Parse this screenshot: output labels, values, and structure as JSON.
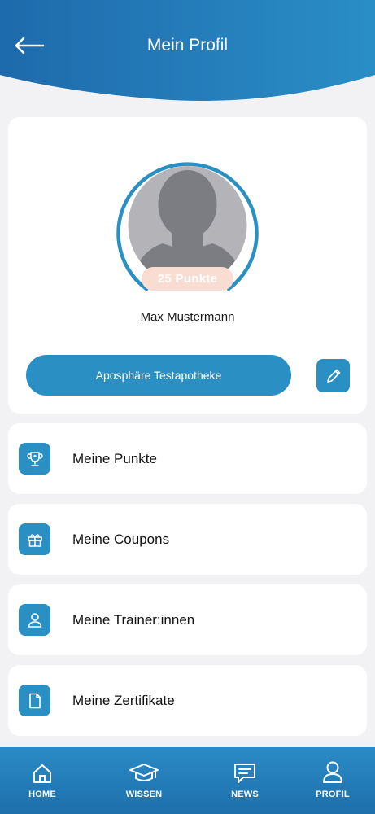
{
  "header": {
    "title": "Mein Profil",
    "back_icon": "arrow-left-icon",
    "gradient_from": "#1e6aab",
    "gradient_to": "#2a8ec6"
  },
  "profile": {
    "points_badge": "25 Punkte",
    "name": "Max Mustermann",
    "pharmacy_button": "Aposphäre Testapotheke",
    "edit_icon": "pencil-icon",
    "progress_ring_color": "#2a8fc3"
  },
  "menu": {
    "items": [
      {
        "label": "Meine Punkte",
        "icon": "trophy-icon"
      },
      {
        "label": "Meine Coupons",
        "icon": "gift-icon"
      },
      {
        "label": "Meine Trainer:innen",
        "icon": "person-icon"
      },
      {
        "label": "Meine Zertifikate",
        "icon": "document-icon"
      }
    ]
  },
  "bottom_nav": {
    "items": [
      {
        "label": "HOME",
        "icon": "home-icon"
      },
      {
        "label": "WISSEN",
        "icon": "graduation-cap-icon"
      },
      {
        "label": "NEWS",
        "icon": "chat-bubble-icon"
      },
      {
        "label": "PROFIL",
        "icon": "profile-icon"
      }
    ]
  },
  "colors": {
    "accent": "#2a8fc3",
    "badge_bg": "#f9dcd2",
    "page_bg": "#f2f2f4"
  }
}
